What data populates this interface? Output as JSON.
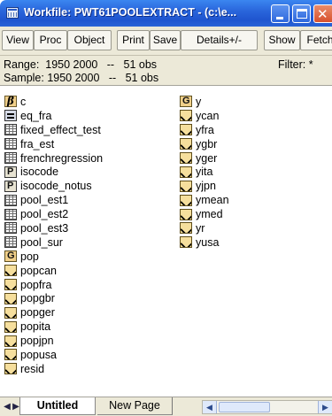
{
  "window": {
    "title": "Workfile: PWT61POOLEXTRACT - (c:\\e...",
    "title_icon": "workfile-icon",
    "controls": {
      "minimize_icon": "minimize-icon",
      "maximize_icon": "maximize-icon",
      "close_icon": "close-icon",
      "close_glyph": "✕"
    }
  },
  "toolbar": {
    "view": "View",
    "proc": "Proc",
    "object": "Object",
    "print": "Print",
    "save": "Save",
    "details": "Details+/-",
    "show": "Show",
    "fetch": "Fetch"
  },
  "info": {
    "range": "Range:  1950 2000   --   51 obs",
    "sample": "Sample: 1950 2000   --   51 obs",
    "filter": "Filter: *"
  },
  "objects_left": [
    {
      "name": "c",
      "type": "coef"
    },
    {
      "name": "eq_fra",
      "type": "equation"
    },
    {
      "name": "fixed_effect_test",
      "type": "table"
    },
    {
      "name": "fra_est",
      "type": "table"
    },
    {
      "name": "frenchregression",
      "type": "table"
    },
    {
      "name": "isocode",
      "type": "pool"
    },
    {
      "name": "isocode_notus",
      "type": "pool"
    },
    {
      "name": "pool_est1",
      "type": "table"
    },
    {
      "name": "pool_est2",
      "type": "table"
    },
    {
      "name": "pool_est3",
      "type": "table"
    },
    {
      "name": "pool_sur",
      "type": "table"
    },
    {
      "name": "pop",
      "type": "group"
    },
    {
      "name": "popcan",
      "type": "series"
    },
    {
      "name": "popfra",
      "type": "series"
    },
    {
      "name": "popgbr",
      "type": "series"
    },
    {
      "name": "popger",
      "type": "series"
    },
    {
      "name": "popita",
      "type": "series"
    },
    {
      "name": "popjpn",
      "type": "series"
    },
    {
      "name": "popusa",
      "type": "series"
    },
    {
      "name": "resid",
      "type": "series"
    }
  ],
  "objects_right": [
    {
      "name": "y",
      "type": "group"
    },
    {
      "name": "ycan",
      "type": "series"
    },
    {
      "name": "yfra",
      "type": "series"
    },
    {
      "name": "ygbr",
      "type": "series"
    },
    {
      "name": "yger",
      "type": "series"
    },
    {
      "name": "yita",
      "type": "series"
    },
    {
      "name": "yjpn",
      "type": "series"
    },
    {
      "name": "ymean",
      "type": "series"
    },
    {
      "name": "ymed",
      "type": "series"
    },
    {
      "name": "yr",
      "type": "series"
    },
    {
      "name": "yusa",
      "type": "series"
    }
  ],
  "tabs": {
    "active": "Untitled",
    "other": "New Page"
  },
  "nav": {
    "left": "◀",
    "right": "▶"
  },
  "scrollbar": {
    "left": "◀",
    "right": "▶"
  },
  "colors": {
    "titlebar": "#2a66dc",
    "chrome": "#ece9d8",
    "close": "#d8512c"
  }
}
